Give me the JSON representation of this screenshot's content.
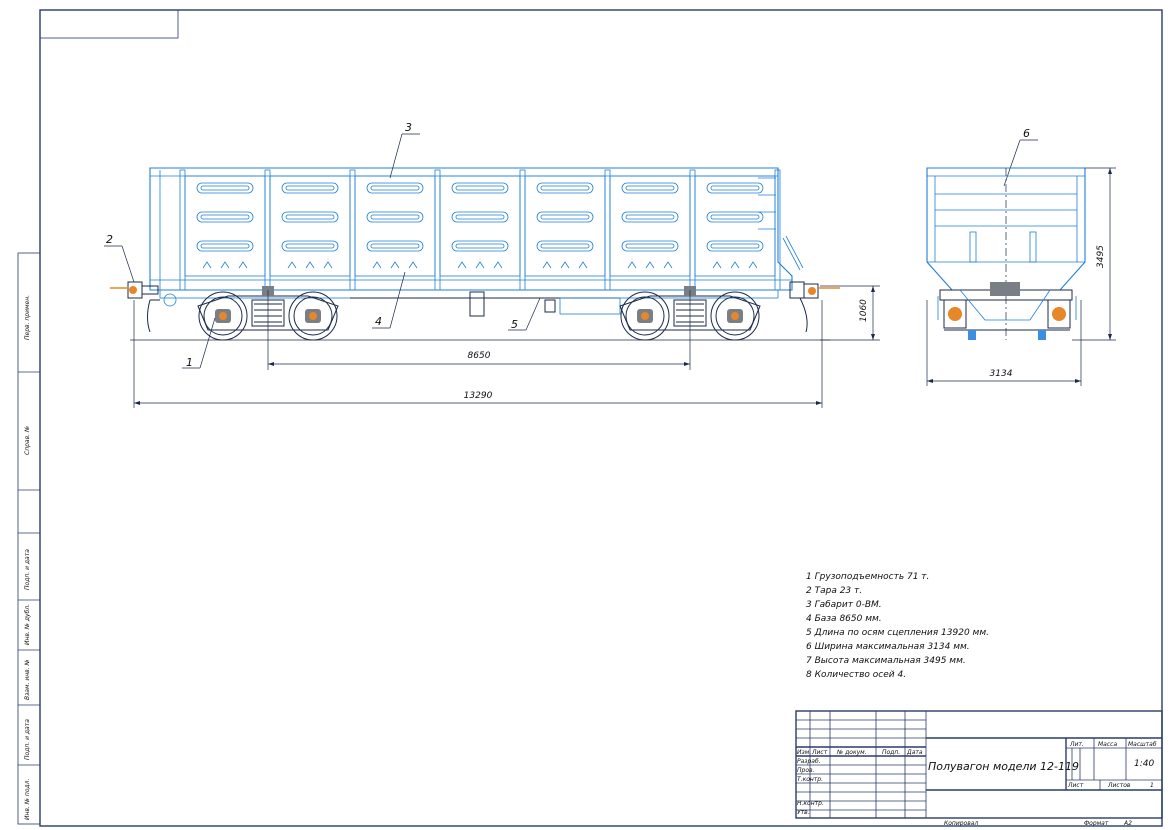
{
  "callouts": {
    "c1": "1",
    "c2": "2",
    "c3": "3",
    "c4": "4",
    "c5": "5",
    "c6": "6"
  },
  "dimensions": {
    "base": "8650",
    "length": "13290",
    "height_small": "1060",
    "width": "3134",
    "height": "3495"
  },
  "specs": [
    "1 Грузоподъемность 71 т.",
    "2 Тара 23 т.",
    "3 Габарит 0-ВМ.",
    "4 База 8650 мм.",
    "5 Длина по осям сцепления 13920 мм.",
    "6 Ширина максимальная 3134 мм.",
    "7 Высота максимальная 3495 мм.",
    "8 Количество осей 4."
  ],
  "side_stamp": [
    "Перв. примен.",
    "Справ. №",
    "Подп. и дата",
    "Инв. № дубл.",
    "Взам. инв. №",
    "Подп. и дата",
    "Инв. № подл."
  ],
  "title_block": {
    "title": "Полувагон модели 12-119",
    "col_izm": "Изм.",
    "col_list": "Лист",
    "col_doc": "№ докум.",
    "col_sign": "Подп.",
    "col_date": "Дата",
    "row_razrab": "Разраб.",
    "row_prov": "Пров.",
    "row_tkontr": "Т.контр.",
    "row_nkontr": "Н.контр.",
    "row_utv": "Утв.",
    "lit": "Лит.",
    "massa": "Масса",
    "masshtab": "Масштаб",
    "scale_value": "1:40",
    "list": "Лист",
    "listov": "Листов",
    "listov_value": "1",
    "kopiroval": "Копировал",
    "format": "Формат",
    "format_value": "A2"
  },
  "colors": {
    "frame": "#2a3b6a",
    "drawing": "#1f7fd8",
    "accent": "#e8862a"
  }
}
